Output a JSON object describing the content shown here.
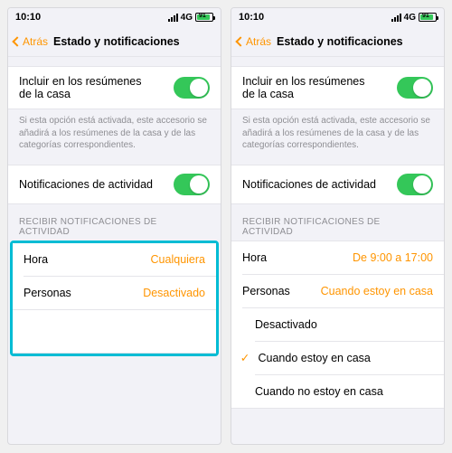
{
  "statusbar": {
    "time": "10:10",
    "network": "4G",
    "battery_pct": "91"
  },
  "nav": {
    "back": "Atrás",
    "title": "Estado y notificaciones"
  },
  "group1": {
    "include_label": "Incluir en los resúmenes de la casa",
    "footnote": "Si esta opción está activada, este accesorio se añadirá a los resúmenes de la casa y de las categorías correspondientes.",
    "activity_label": "Notificaciones de actividad"
  },
  "section_header": "RECIBIR NOTIFICACIONES DE ACTIVIDAD",
  "left": {
    "hora_label": "Hora",
    "hora_value": "Cualquiera",
    "personas_label": "Personas",
    "personas_value": "Desactivado"
  },
  "right": {
    "hora_label": "Hora",
    "hora_value": "De 9:00 a 17:00",
    "personas_label": "Personas",
    "personas_value": "Cuando estoy en casa",
    "options": {
      "o1": "Desactivado",
      "o2": "Cuando estoy en casa",
      "o3": "Cuando no estoy en casa"
    },
    "checkmark": "✓"
  }
}
